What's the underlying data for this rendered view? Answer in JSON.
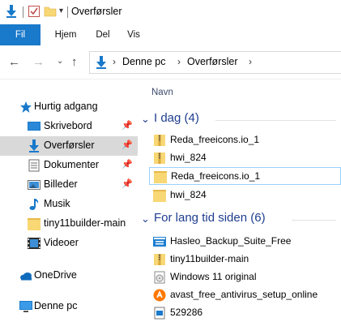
{
  "window": {
    "title": "Overførsler"
  },
  "ribbon": {
    "tabs": [
      {
        "label": "Fil",
        "active": true
      },
      {
        "label": "Hjem"
      },
      {
        "label": "Del"
      },
      {
        "label": "Vis"
      }
    ]
  },
  "address": {
    "crumbs": [
      "Denne pc",
      "Overførsler"
    ]
  },
  "sidebar": {
    "items": [
      {
        "label": "Hurtig adgang",
        "icon": "star-icon"
      },
      {
        "label": "Skrivebord",
        "icon": "desktop-icon",
        "pinned": true
      },
      {
        "label": "Overførsler",
        "icon": "download-arrow-icon",
        "pinned": true,
        "selected": true
      },
      {
        "label": "Dokumenter",
        "icon": "document-icon",
        "pinned": true
      },
      {
        "label": "Billeder",
        "icon": "pictures-icon",
        "pinned": true
      },
      {
        "label": "Musik",
        "icon": "music-icon"
      },
      {
        "label": "tiny11builder-main",
        "icon": "folder-icon"
      },
      {
        "label": "Videoer",
        "icon": "video-icon"
      },
      {
        "label": "OneDrive",
        "icon": "cloud-icon"
      },
      {
        "label": "Denne pc",
        "icon": "computer-icon"
      }
    ]
  },
  "content": {
    "column_header": "Navn",
    "groups": [
      {
        "title": "I dag (4)",
        "files": [
          {
            "name": "Reda_freeicons.io_1",
            "icon": "zip-folder-icon"
          },
          {
            "name": "hwi_824",
            "icon": "zip-folder-icon"
          },
          {
            "name": "Reda_freeicons.io_1",
            "icon": "folder-icon",
            "focused": true
          },
          {
            "name": "hwi_824",
            "icon": "folder-icon"
          }
        ]
      },
      {
        "title": "For lang tid siden (6)",
        "files": [
          {
            "name": "Hasleo_Backup_Suite_Free",
            "icon": "installer-icon"
          },
          {
            "name": "tiny11builder-main",
            "icon": "zip-folder-icon"
          },
          {
            "name": "Windows 11 original",
            "icon": "disc-image-icon"
          },
          {
            "name": "avast_free_antivirus_setup_online",
            "icon": "avast-icon"
          },
          {
            "name": "529286",
            "icon": "file-icon"
          }
        ]
      }
    ]
  },
  "colors": {
    "accent": "#1979ca",
    "folder": "#f8d775",
    "group_title": "#1e3d8f",
    "selected_bg": "#d9d9d9"
  }
}
